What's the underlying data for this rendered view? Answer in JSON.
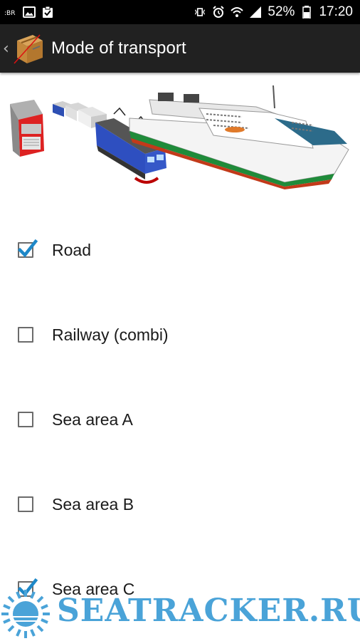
{
  "status_bar": {
    "battery_percent": "52%",
    "time": "17:20",
    "icons_left": [
      "app-notification-icon",
      "image-icon",
      "clipboard-check-icon"
    ],
    "icons_right": [
      "vibrate-icon",
      "alarm-icon",
      "wifi-icon",
      "signal-icon",
      "battery-icon"
    ]
  },
  "action_bar": {
    "back_icon": "chevron-left-icon",
    "logo_icon": "parcel-logo-icon",
    "title": "Mode of transport"
  },
  "illustration": {
    "items": [
      "truck-illustration",
      "train-illustration",
      "ferry-illustration"
    ]
  },
  "options": [
    {
      "label": "Road",
      "checked": true
    },
    {
      "label": "Railway (combi)",
      "checked": false
    },
    {
      "label": "Sea area A",
      "checked": false
    },
    {
      "label": "Sea area B",
      "checked": false
    },
    {
      "label": "Sea area C",
      "checked": true
    }
  ],
  "watermark": {
    "text": "SEATRACKER.RU",
    "color": "#4aa3d8"
  },
  "colors": {
    "status_bar_bg": "#000000",
    "action_bar_bg": "#212121",
    "checkbox_check": "#1e88c8"
  }
}
